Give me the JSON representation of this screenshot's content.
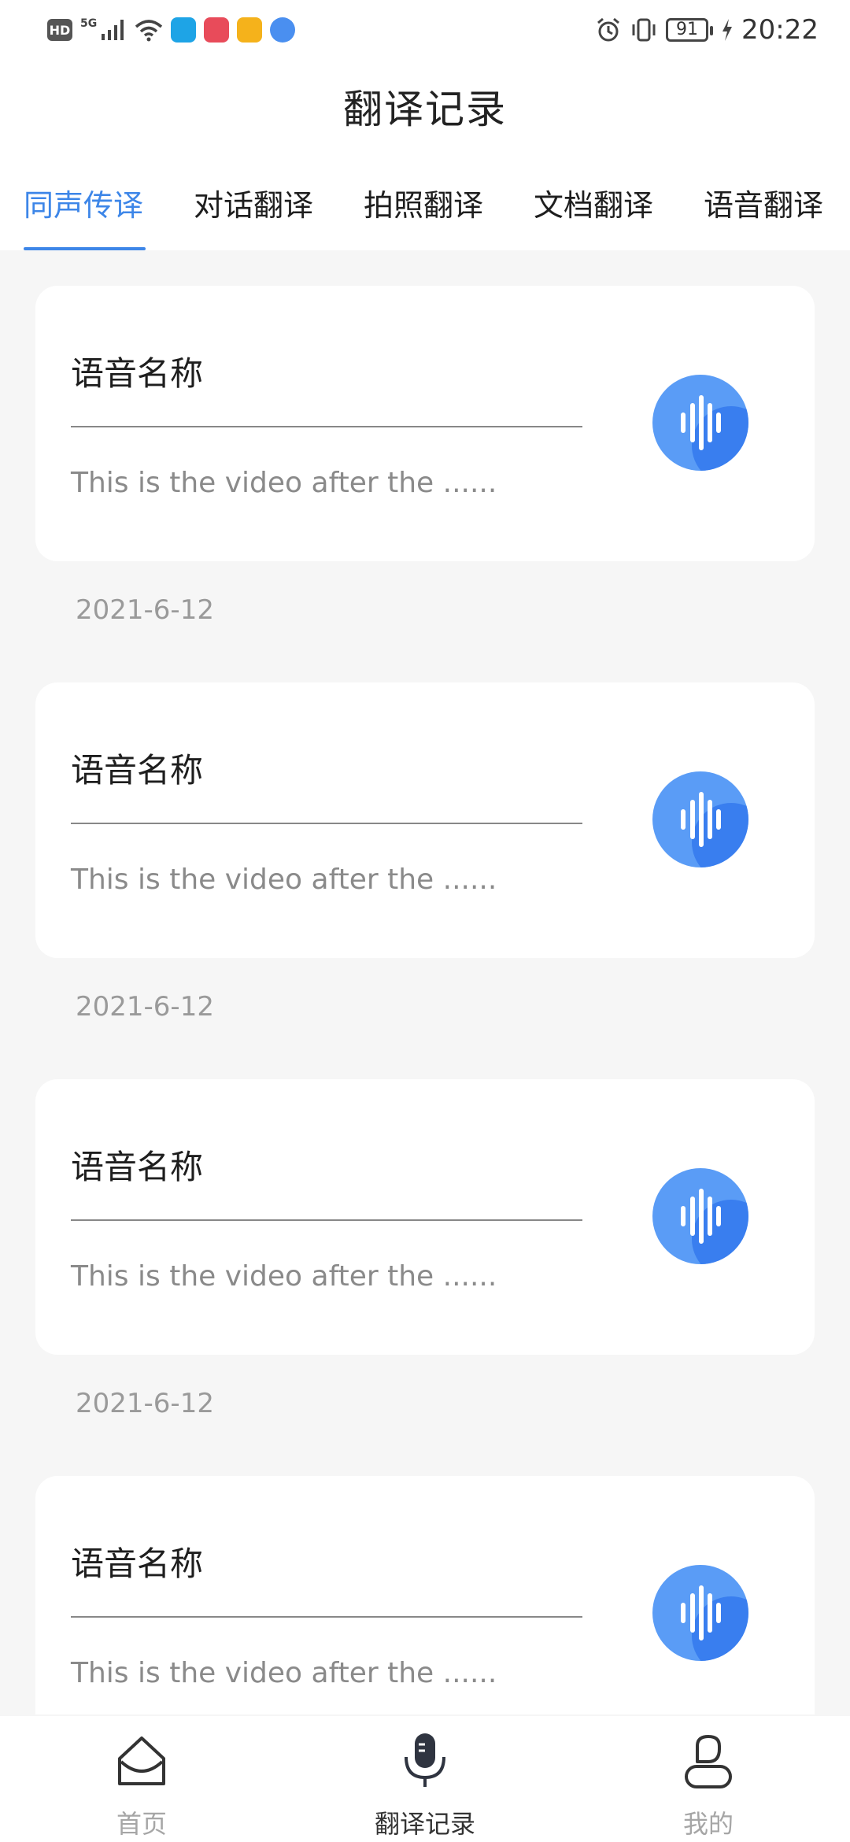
{
  "status_bar": {
    "net_label": "5G",
    "battery": "91",
    "time": "20:22"
  },
  "header": {
    "title": "翻译记录"
  },
  "tabs": [
    {
      "label": "同声传译",
      "active": true
    },
    {
      "label": "对话翻译"
    },
    {
      "label": "拍照翻译"
    },
    {
      "label": "文档翻译"
    },
    {
      "label": "语音翻译"
    }
  ],
  "records": [
    {
      "title": "语音名称",
      "desc": "This is the video after the ......",
      "date": "2021-6-12"
    },
    {
      "title": "语音名称",
      "desc": "This is the video after the ......",
      "date": "2021-6-12"
    },
    {
      "title": "语音名称",
      "desc": "This is the video after the ......",
      "date": "2021-6-12"
    },
    {
      "title": "语音名称",
      "desc": "This is the video after the ......"
    }
  ],
  "bottom_nav": [
    {
      "label": "首页",
      "icon": "home-icon"
    },
    {
      "label": "翻译记录",
      "icon": "microphone-icon",
      "active": true
    },
    {
      "label": "我的",
      "icon": "profile-icon"
    }
  ],
  "colors": {
    "accent": "#3d86e8",
    "voice_button": "#5a9cf6",
    "background": "#f6f6f6"
  }
}
